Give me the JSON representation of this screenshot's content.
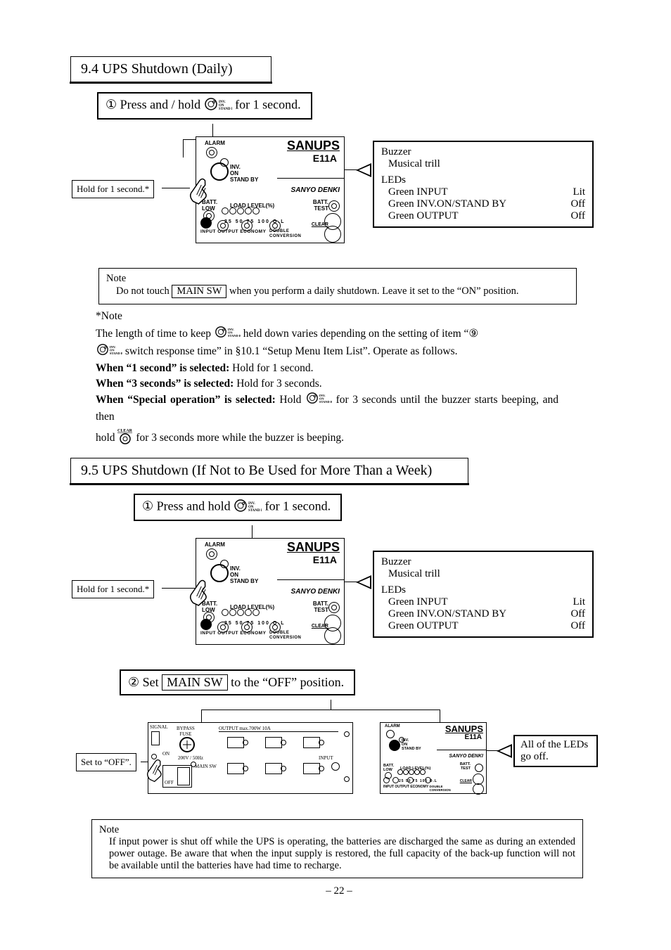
{
  "section94": {
    "title": "9.4 UPS Shutdown (Daily)",
    "step1_prefix": "①  Press and / hold",
    "step1_suffix": "for 1 second.",
    "hold_label": "Hold for 1 second.*",
    "status": {
      "buzzer_h": "Buzzer",
      "buzzer_v": "Musical trill",
      "leds_h": "LEDs",
      "r1_l": "Green INPUT",
      "r1_v": "Lit",
      "r2_l": "Green INV.ON/STAND BY",
      "r2_v": "Off",
      "r3_l": "Green OUTPUT",
      "r3_v": "Off"
    },
    "note_box": {
      "head": "Note",
      "pre": "Do not touch",
      "sw": "MAIN SW",
      "post": "when you perform a daily shutdown. Leave it set to the “ON” position."
    }
  },
  "note_star": {
    "head": "*Note",
    "p1_pre": "The length of time to keep",
    "p1_post": "held down varies depending on the setting of item “⑨",
    "p2": "switch response time” in §10.1 “Setup Menu Item List”. Operate as follows.",
    "b1_head": "When “1 second” is selected:",
    "b1_tail": " Hold for 1 second.",
    "b2_head": "When “3 seconds” is selected:",
    "b2_tail": " Hold for 3 seconds.",
    "b3_head": "When “Special operation” is selected:",
    "b3_mid": " Hold ",
    "b3_tail": " for 3 seconds until the buzzer starts beeping, and then",
    "b4_pre": "hold ",
    "b4_post": " for 3 seconds more while the buzzer is beeping."
  },
  "section95": {
    "title": "9.5 UPS Shutdown (If Not to Be Used for More Than a Week)",
    "step1_prefix": "①  Press and hold",
    "step1_suffix": "for 1 second.",
    "hold_label": "Hold for 1 second.*",
    "status": {
      "buzzer_h": "Buzzer",
      "buzzer_v": "Musical trill",
      "leds_h": "LEDs",
      "r1_l": "Green INPUT",
      "r1_v": "Lit",
      "r2_l": "Green INV.ON/STAND BY",
      "r2_v": "Off",
      "r3_l": "Green OUTPUT",
      "r3_v": "Off"
    },
    "step2_prefix": "②  Set",
    "step2_sw": "MAIN SW",
    "step2_suffix": "to the “OFF” position.",
    "set_off_label": "Set to “OFF”.",
    "all_off": "All of the LEDs go off.",
    "note_box": {
      "head": "Note",
      "body": "If input power is shut off while the UPS is operating, the batteries are discharged the same as during an extended power outage. Be aware that when the input supply is restored, the full capacity of the back-up function will not be available until the batteries have had time to recharge."
    }
  },
  "device": {
    "alarm": "ALARM",
    "brand": "SANUPS",
    "model": "E11A",
    "denki": "SANYO DENKI",
    "inv": "INV.\nON\nSTAND BY",
    "batt": "BATT.\nLOW",
    "test": "BATT.\nTEST",
    "load": "LOAD LEVEL(%)",
    "scale": "25 50 75 100 O.L",
    "bottom": "INPUT OUTPUT ECONOMY",
    "double": "DOUBLE\nCONVERSION",
    "clear": "CLEAR"
  },
  "rear": {
    "bypass": "BYPASS\nFUSE",
    "output": "OUTPUT max.700W 10A",
    "mainsw": "MAIN SW",
    "input": "INPUT",
    "off": "OFF",
    "dip": "200V / 50Hz",
    "sig": "SIGNAL"
  },
  "pagenum": "–  22  –"
}
